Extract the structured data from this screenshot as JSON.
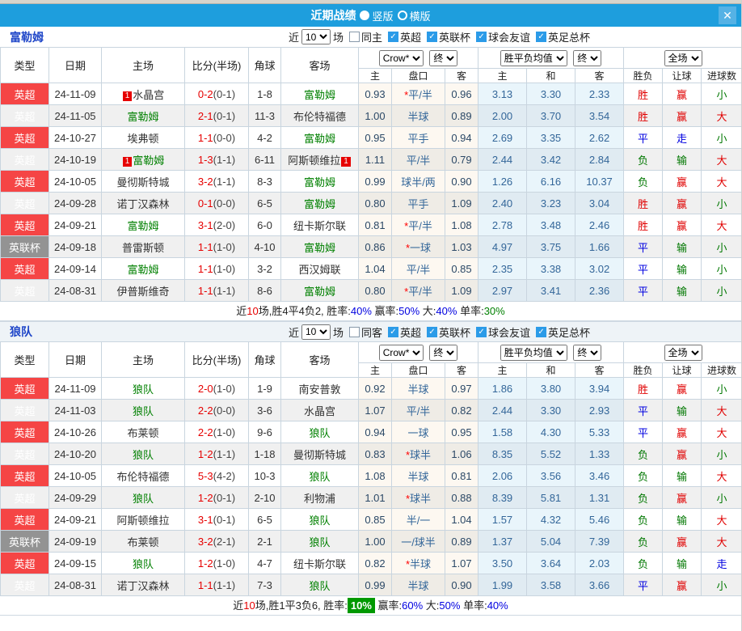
{
  "titlebar": {
    "title": "近期战绩",
    "radio_vertical": "竖版",
    "radio_horizontal": "横版",
    "close": "✕"
  },
  "filters": {
    "near_label": "近",
    "count_value": "10",
    "matches_label": "场",
    "leagues": [
      "英超",
      "英联杯",
      "球会友谊",
      "英足总杯"
    ]
  },
  "table_header": {
    "cols": [
      "类型",
      "日期",
      "主场",
      "比分(半场)",
      "角球",
      "客场"
    ],
    "crown_select": "Crow*",
    "final_select": "终",
    "crown_cols": [
      "主",
      "盘口",
      "客"
    ],
    "mean_select": "胜平负均值",
    "mean_final_select": "终",
    "mean_cols": [
      "主",
      "和",
      "客"
    ],
    "fullmatch_select": "全场",
    "result_cols": [
      "胜负",
      "让球",
      "进球数"
    ]
  },
  "result_color_map": {
    "胜": "red",
    "赢": "red",
    "大": "red",
    "平": "blue",
    "走": "blue",
    "负": "green",
    "输": "green",
    "小": "green"
  },
  "sections": [
    {
      "team": "富勒姆",
      "same_label": "同主",
      "rows": [
        {
          "league": "英超",
          "cup": false,
          "date": "24-11-09",
          "home": "水晶宫",
          "homeGreen": false,
          "homeBadge": "1",
          "score": "0-2",
          "half": "(0-1)",
          "corner": "1-8",
          "away": "富勒姆",
          "awayGreen": true,
          "awayBadge": null,
          "h": "0.93",
          "star": true,
          "pan": "平/半",
          "a": "0.96",
          "m1": "3.13",
          "m2": "3.30",
          "m3": "2.33",
          "r1": "胜",
          "r2": "赢",
          "r3": "小"
        },
        {
          "league": "英超",
          "cup": false,
          "date": "24-11-05",
          "home": "富勒姆",
          "homeGreen": true,
          "homeBadge": null,
          "score": "2-1",
          "half": "(0-1)",
          "corner": "11-3",
          "away": "布伦特福德",
          "awayGreen": false,
          "awayBadge": null,
          "h": "1.00",
          "star": false,
          "pan": "半球",
          "a": "0.89",
          "m1": "2.00",
          "m2": "3.70",
          "m3": "3.54",
          "r1": "胜",
          "r2": "赢",
          "r3": "大"
        },
        {
          "league": "英超",
          "cup": false,
          "date": "24-10-27",
          "home": "埃弗顿",
          "homeGreen": false,
          "homeBadge": null,
          "score": "1-1",
          "half": "(0-0)",
          "corner": "4-2",
          "away": "富勒姆",
          "awayGreen": true,
          "awayBadge": null,
          "h": "0.95",
          "star": false,
          "pan": "平手",
          "a": "0.94",
          "m1": "2.69",
          "m2": "3.35",
          "m3": "2.62",
          "r1": "平",
          "r2": "走",
          "r3": "小"
        },
        {
          "league": "英超",
          "cup": false,
          "date": "24-10-19",
          "home": "富勒姆",
          "homeGreen": true,
          "homeBadge": "1",
          "score": "1-3",
          "half": "(1-1)",
          "corner": "6-11",
          "away": "阿斯顿维拉",
          "awayGreen": false,
          "awayBadge": "1",
          "h": "1.11",
          "star": false,
          "pan": "平/半",
          "a": "0.79",
          "m1": "2.44",
          "m2": "3.42",
          "m3": "2.84",
          "r1": "负",
          "r2": "输",
          "r3": "大"
        },
        {
          "league": "英超",
          "cup": false,
          "date": "24-10-05",
          "home": "曼彻斯特城",
          "homeGreen": false,
          "homeBadge": null,
          "score": "3-2",
          "half": "(1-1)",
          "corner": "8-3",
          "away": "富勒姆",
          "awayGreen": true,
          "awayBadge": null,
          "h": "0.99",
          "star": false,
          "pan": "球半/两",
          "a": "0.90",
          "m1": "1.26",
          "m2": "6.16",
          "m3": "10.37",
          "r1": "负",
          "r2": "赢",
          "r3": "大"
        },
        {
          "league": "英超",
          "cup": false,
          "date": "24-09-28",
          "home": "诺丁汉森林",
          "homeGreen": false,
          "homeBadge": null,
          "score": "0-1",
          "half": "(0-0)",
          "corner": "6-5",
          "away": "富勒姆",
          "awayGreen": true,
          "awayBadge": null,
          "h": "0.80",
          "star": false,
          "pan": "平手",
          "a": "1.09",
          "m1": "2.40",
          "m2": "3.23",
          "m3": "3.04",
          "r1": "胜",
          "r2": "赢",
          "r3": "小"
        },
        {
          "league": "英超",
          "cup": false,
          "date": "24-09-21",
          "home": "富勒姆",
          "homeGreen": true,
          "homeBadge": null,
          "score": "3-1",
          "half": "(2-0)",
          "corner": "6-0",
          "away": "纽卡斯尔联",
          "awayGreen": false,
          "awayBadge": null,
          "h": "0.81",
          "star": true,
          "pan": "平/半",
          "a": "1.08",
          "m1": "2.78",
          "m2": "3.48",
          "m3": "2.46",
          "r1": "胜",
          "r2": "赢",
          "r3": "大"
        },
        {
          "league": "英联杯",
          "cup": true,
          "date": "24-09-18",
          "home": "普雷斯顿",
          "homeGreen": false,
          "homeBadge": null,
          "score": "1-1",
          "half": "(1-0)",
          "corner": "4-10",
          "away": "富勒姆",
          "awayGreen": true,
          "awayBadge": null,
          "h": "0.86",
          "star": true,
          "pan": "一球",
          "a": "1.03",
          "m1": "4.97",
          "m2": "3.75",
          "m3": "1.66",
          "r1": "平",
          "r2": "输",
          "r3": "小"
        },
        {
          "league": "英超",
          "cup": false,
          "date": "24-09-14",
          "home": "富勒姆",
          "homeGreen": true,
          "homeBadge": null,
          "score": "1-1",
          "half": "(1-0)",
          "corner": "3-2",
          "away": "西汉姆联",
          "awayGreen": false,
          "awayBadge": null,
          "h": "1.04",
          "star": false,
          "pan": "平/半",
          "a": "0.85",
          "m1": "2.35",
          "m2": "3.38",
          "m3": "3.02",
          "r1": "平",
          "r2": "输",
          "r3": "小"
        },
        {
          "league": "英超",
          "cup": false,
          "date": "24-08-31",
          "home": "伊普斯维奇",
          "homeGreen": false,
          "homeBadge": null,
          "score": "1-1",
          "half": "(1-1)",
          "corner": "8-6",
          "away": "富勒姆",
          "awayGreen": true,
          "awayBadge": null,
          "h": "0.80",
          "star": true,
          "pan": "平/半",
          "a": "1.09",
          "m1": "2.97",
          "m2": "3.41",
          "m3": "2.36",
          "r1": "平",
          "r2": "输",
          "r3": "小"
        }
      ],
      "summary_parts": [
        {
          "t": "近"
        },
        {
          "t": "10",
          "c": "red"
        },
        {
          "t": "场,胜4平4负2, 胜率:"
        },
        {
          "t": "40%",
          "c": "blue"
        },
        {
          "t": " 赢率:"
        },
        {
          "t": "50%",
          "c": "blue"
        },
        {
          "t": " 大:"
        },
        {
          "t": "40%",
          "c": "blue"
        },
        {
          "t": " 单率:"
        },
        {
          "t": "30%",
          "c": "green"
        }
      ]
    },
    {
      "team": "狼队",
      "same_label": "同客",
      "rows": [
        {
          "league": "英超",
          "cup": false,
          "date": "24-11-09",
          "home": "狼队",
          "homeGreen": true,
          "homeBadge": null,
          "score": "2-0",
          "half": "(1-0)",
          "corner": "1-9",
          "away": "南安普敦",
          "awayGreen": false,
          "awayBadge": null,
          "h": "0.92",
          "star": false,
          "pan": "半球",
          "a": "0.97",
          "m1": "1.86",
          "m2": "3.80",
          "m3": "3.94",
          "r1": "胜",
          "r2": "赢",
          "r3": "小"
        },
        {
          "league": "英超",
          "cup": false,
          "date": "24-11-03",
          "home": "狼队",
          "homeGreen": true,
          "homeBadge": null,
          "score": "2-2",
          "half": "(0-0)",
          "corner": "3-6",
          "away": "水晶宫",
          "awayGreen": false,
          "awayBadge": null,
          "h": "1.07",
          "star": false,
          "pan": "平/半",
          "a": "0.82",
          "m1": "2.44",
          "m2": "3.30",
          "m3": "2.93",
          "r1": "平",
          "r2": "输",
          "r3": "大"
        },
        {
          "league": "英超",
          "cup": false,
          "date": "24-10-26",
          "home": "布莱顿",
          "homeGreen": false,
          "homeBadge": null,
          "score": "2-2",
          "half": "(1-0)",
          "corner": "9-6",
          "away": "狼队",
          "awayGreen": true,
          "awayBadge": null,
          "h": "0.94",
          "star": false,
          "pan": "一球",
          "a": "0.95",
          "m1": "1.58",
          "m2": "4.30",
          "m3": "5.33",
          "r1": "平",
          "r2": "赢",
          "r3": "大"
        },
        {
          "league": "英超",
          "cup": false,
          "date": "24-10-20",
          "home": "狼队",
          "homeGreen": true,
          "homeBadge": null,
          "score": "1-2",
          "half": "(1-1)",
          "corner": "1-18",
          "away": "曼彻斯特城",
          "awayGreen": false,
          "awayBadge": null,
          "h": "0.83",
          "star": true,
          "pan": "球半",
          "a": "1.06",
          "m1": "8.35",
          "m2": "5.52",
          "m3": "1.33",
          "r1": "负",
          "r2": "赢",
          "r3": "小"
        },
        {
          "league": "英超",
          "cup": false,
          "date": "24-10-05",
          "home": "布伦特福德",
          "homeGreen": false,
          "homeBadge": null,
          "score": "5-3",
          "half": "(4-2)",
          "corner": "10-3",
          "away": "狼队",
          "awayGreen": true,
          "awayBadge": null,
          "h": "1.08",
          "star": false,
          "pan": "半球",
          "a": "0.81",
          "m1": "2.06",
          "m2": "3.56",
          "m3": "3.46",
          "r1": "负",
          "r2": "输",
          "r3": "大"
        },
        {
          "league": "英超",
          "cup": false,
          "date": "24-09-29",
          "home": "狼队",
          "homeGreen": true,
          "homeBadge": null,
          "score": "1-2",
          "half": "(0-1)",
          "corner": "2-10",
          "away": "利物浦",
          "awayGreen": false,
          "awayBadge": null,
          "h": "1.01",
          "star": true,
          "pan": "球半",
          "a": "0.88",
          "m1": "8.39",
          "m2": "5.81",
          "m3": "1.31",
          "r1": "负",
          "r2": "赢",
          "r3": "小"
        },
        {
          "league": "英超",
          "cup": false,
          "date": "24-09-21",
          "home": "阿斯顿维拉",
          "homeGreen": false,
          "homeBadge": null,
          "score": "3-1",
          "half": "(0-1)",
          "corner": "6-5",
          "away": "狼队",
          "awayGreen": true,
          "awayBadge": null,
          "h": "0.85",
          "star": false,
          "pan": "半/一",
          "a": "1.04",
          "m1": "1.57",
          "m2": "4.32",
          "m3": "5.46",
          "r1": "负",
          "r2": "输",
          "r3": "大"
        },
        {
          "league": "英联杯",
          "cup": true,
          "date": "24-09-19",
          "home": "布莱顿",
          "homeGreen": false,
          "homeBadge": null,
          "score": "3-2",
          "half": "(2-1)",
          "corner": "2-1",
          "away": "狼队",
          "awayGreen": true,
          "awayBadge": null,
          "h": "1.00",
          "star": false,
          "pan": "一/球半",
          "a": "0.89",
          "m1": "1.37",
          "m2": "5.04",
          "m3": "7.39",
          "r1": "负",
          "r2": "赢",
          "r3": "大"
        },
        {
          "league": "英超",
          "cup": false,
          "date": "24-09-15",
          "home": "狼队",
          "homeGreen": true,
          "homeBadge": null,
          "score": "1-2",
          "half": "(1-0)",
          "corner": "4-7",
          "away": "纽卡斯尔联",
          "awayGreen": false,
          "awayBadge": null,
          "h": "0.82",
          "star": true,
          "pan": "半球",
          "a": "1.07",
          "m1": "3.50",
          "m2": "3.64",
          "m3": "2.03",
          "r1": "负",
          "r2": "输",
          "r3": "走"
        },
        {
          "league": "英超",
          "cup": false,
          "date": "24-08-31",
          "home": "诺丁汉森林",
          "homeGreen": false,
          "homeBadge": null,
          "score": "1-1",
          "half": "(1-1)",
          "corner": "7-3",
          "away": "狼队",
          "awayGreen": true,
          "awayBadge": null,
          "h": "0.99",
          "star": false,
          "pan": "半球",
          "a": "0.90",
          "m1": "1.99",
          "m2": "3.58",
          "m3": "3.66",
          "r1": "平",
          "r2": "赢",
          "r3": "小"
        }
      ],
      "summary_parts": [
        {
          "t": "近"
        },
        {
          "t": "10",
          "c": "red"
        },
        {
          "t": "场,胜1平3负6, 胜率:"
        },
        {
          "t": "10%",
          "c": "greenbox"
        },
        {
          "t": " 赢率:"
        },
        {
          "t": "60%",
          "c": "blue"
        },
        {
          "t": " 大:"
        },
        {
          "t": "50%",
          "c": "blue"
        },
        {
          "t": " 单率:"
        },
        {
          "t": "40%",
          "c": "blue"
        }
      ]
    }
  ]
}
